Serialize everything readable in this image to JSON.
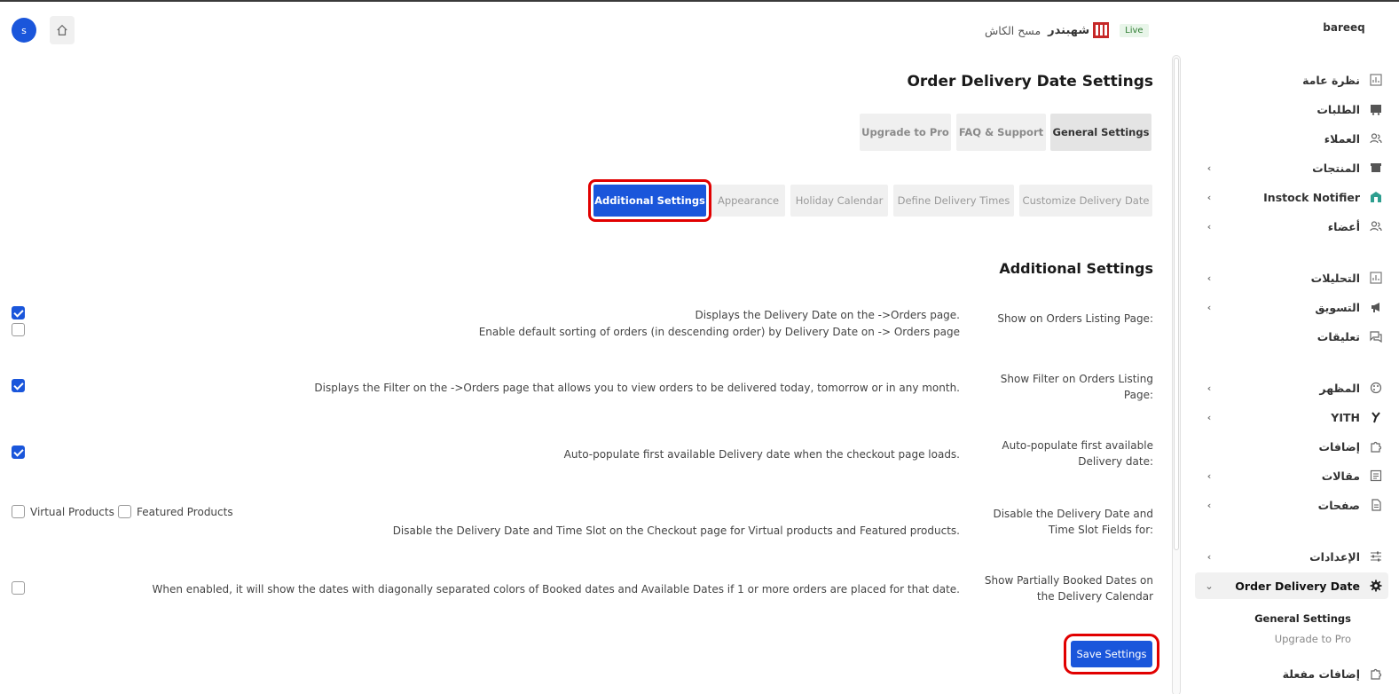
{
  "header": {
    "avatar_letter": "s",
    "brand": "bareeq",
    "store_name": "شهبندر",
    "live_badge": "Live",
    "clear_cache": "مسح الكاش"
  },
  "sidebar": {
    "items": [
      {
        "label": "نظرة عامة",
        "icon": "chart-icon",
        "has_chevron": false
      },
      {
        "label": "الطلبات",
        "icon": "cart-icon",
        "has_chevron": false
      },
      {
        "label": "العملاء",
        "icon": "users-icon",
        "has_chevron": false
      },
      {
        "label": "المنتجات",
        "icon": "box-icon",
        "has_chevron": true
      },
      {
        "label": "Instock Notifier",
        "icon": "store-icon",
        "has_chevron": true
      },
      {
        "label": "أعضاء",
        "icon": "members-icon",
        "has_chevron": true
      },
      {
        "label": "التحليلات",
        "icon": "analytics-icon",
        "has_chevron": true
      },
      {
        "label": "التسويق",
        "icon": "megaphone-icon",
        "has_chevron": true
      },
      {
        "label": "تعليقات",
        "icon": "comments-icon",
        "has_chevron": false
      },
      {
        "label": "المظهر",
        "icon": "palette-icon",
        "has_chevron": true
      },
      {
        "label": "YITH",
        "icon": "yith-icon",
        "has_chevron": true
      },
      {
        "label": "إضافات",
        "icon": "puzzle-icon",
        "has_chevron": false
      },
      {
        "label": "مقالات",
        "icon": "posts-icon",
        "has_chevron": true
      },
      {
        "label": "صفحات",
        "icon": "pages-icon",
        "has_chevron": true
      },
      {
        "label": "الإعدادات",
        "icon": "sliders-icon",
        "has_chevron": true
      },
      {
        "label": "Order Delivery Date",
        "icon": "gear-icon",
        "has_chevron": true,
        "active": true
      },
      {
        "label": "إضافات مفعلة",
        "icon": "puzzle-icon",
        "has_chevron": false
      }
    ],
    "submenu": [
      "General Settings",
      "Upgrade to Pro"
    ]
  },
  "main": {
    "title": "Order Delivery Date Settings",
    "tabs": [
      "Upgrade to Pro",
      "FAQ & Support",
      "General Settings"
    ],
    "selected_tab": "General Settings",
    "subtabs": [
      "Additional Settings",
      "Appearance",
      "Holiday Calendar",
      "Define Delivery Times",
      "Customize Delivery Date"
    ],
    "selected_subtab": "Additional Settings",
    "section_title": "Additional Settings",
    "rows": [
      {
        "label": "Show on Orders Listing Page:",
        "desc1": "Displays the Delivery Date on the ->Orders page.",
        "desc2": "Enable default sorting of orders (in descending order) by Delivery Date on -> Orders page"
      },
      {
        "label": "Show Filter on Orders Listing Page:",
        "desc1": "Displays the Filter on the ->Orders page that allows you to view orders to be delivered today, tomorrow or in any month."
      },
      {
        "label": "Auto-populate first available Delivery date:",
        "desc1": "Auto-populate first available Delivery date when the checkout page loads."
      },
      {
        "label": "Disable the Delivery Date and Time Slot Fields for:",
        "desc1": "Disable the Delivery Date and Time Slot on the Checkout page for Virtual products and Featured products.",
        "opt_virtual": "Virtual Products",
        "opt_featured": "Featured Products"
      },
      {
        "label": "Show Partially Booked Dates on the Delivery Calendar",
        "desc1": "When enabled, it will show the dates with diagonally separated colors of Booked dates and Available Dates if 1 or more orders are placed for that date."
      }
    ],
    "checkboxes": {
      "show_on_orders": true,
      "default_sorting": false,
      "show_filter": true,
      "auto_populate": true,
      "virtual_products": false,
      "featured_products": false,
      "partially_booked": false
    },
    "save_label": "Save Settings"
  }
}
